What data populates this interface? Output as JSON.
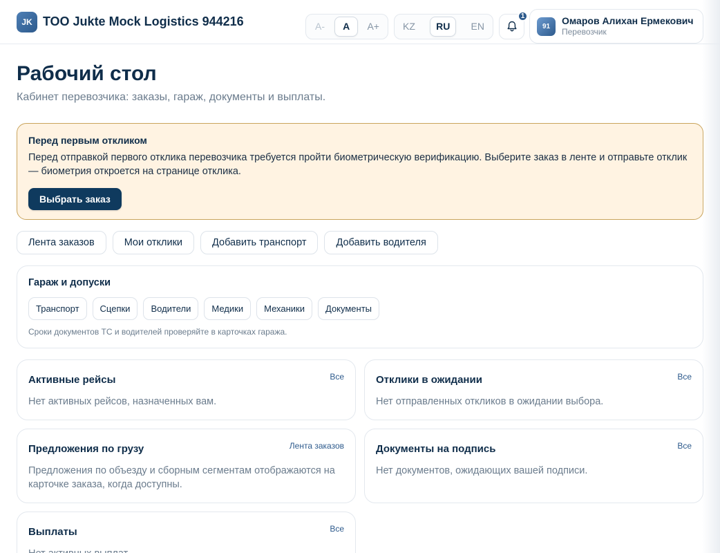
{
  "header": {
    "logo_initials": "JK",
    "company_name": "ТОО Jukte Mock Logistics 944216",
    "font_size_controls": [
      "A-",
      "A",
      "A+"
    ],
    "font_size_active": "A",
    "languages": [
      "KZ",
      "RU",
      "EN"
    ],
    "language_active": "RU",
    "notifications_count": "1",
    "user": {
      "avatar_text": "91",
      "name": "Омаров Алихан Ермекович",
      "role": "Перевозчик"
    }
  },
  "page": {
    "title": "Рабочий стол",
    "subtitle": "Кабинет перевозчика: заказы, гараж, документы и выплаты."
  },
  "alert": {
    "title": "Перед первым откликом",
    "text": "Перед отправкой первого отклика перевозчика требуется пройти биометрическую верификацию. Выберите заказ в ленте и отправьте отклик — биометрия откроется на странице отклика.",
    "button": "Выбрать заказ"
  },
  "quick_actions": [
    "Лента заказов",
    "Мои отклики",
    "Добавить транспорт",
    "Добавить водителя"
  ],
  "garage": {
    "title": "Гараж и допуски",
    "chips": [
      "Транспорт",
      "Сцепки",
      "Водители",
      "Медики",
      "Механики",
      "Документы"
    ],
    "note": "Сроки документов ТС и водителей проверяйте в карточках гаража."
  },
  "tiles": [
    {
      "title": "Активные рейсы",
      "link": "Все",
      "text": "Нет активных рейсов, назначенных вам."
    },
    {
      "title": "Отклики в ожидании",
      "link": "Все",
      "text": "Нет отправленных откликов в ожидании выбора."
    },
    {
      "title": "Предложения по грузу",
      "link": "Лента заказов",
      "text": "Предложения по объезду и сборным сегментам отображаются на карточке заказа, когда доступны."
    },
    {
      "title": "Документы на подпись",
      "link": "Все",
      "text": "Нет документов, ожидающих вашей подписи."
    },
    {
      "title": "Выплаты",
      "link": "Все",
      "text": "Нет активных выплат."
    }
  ],
  "colors": {
    "primary": "#0f3a5e",
    "accent": "#2d5a8c",
    "alert_bg": "#fff3e2",
    "alert_border": "#c9a45c"
  },
  "icons": {
    "notifications": "bell-icon"
  }
}
